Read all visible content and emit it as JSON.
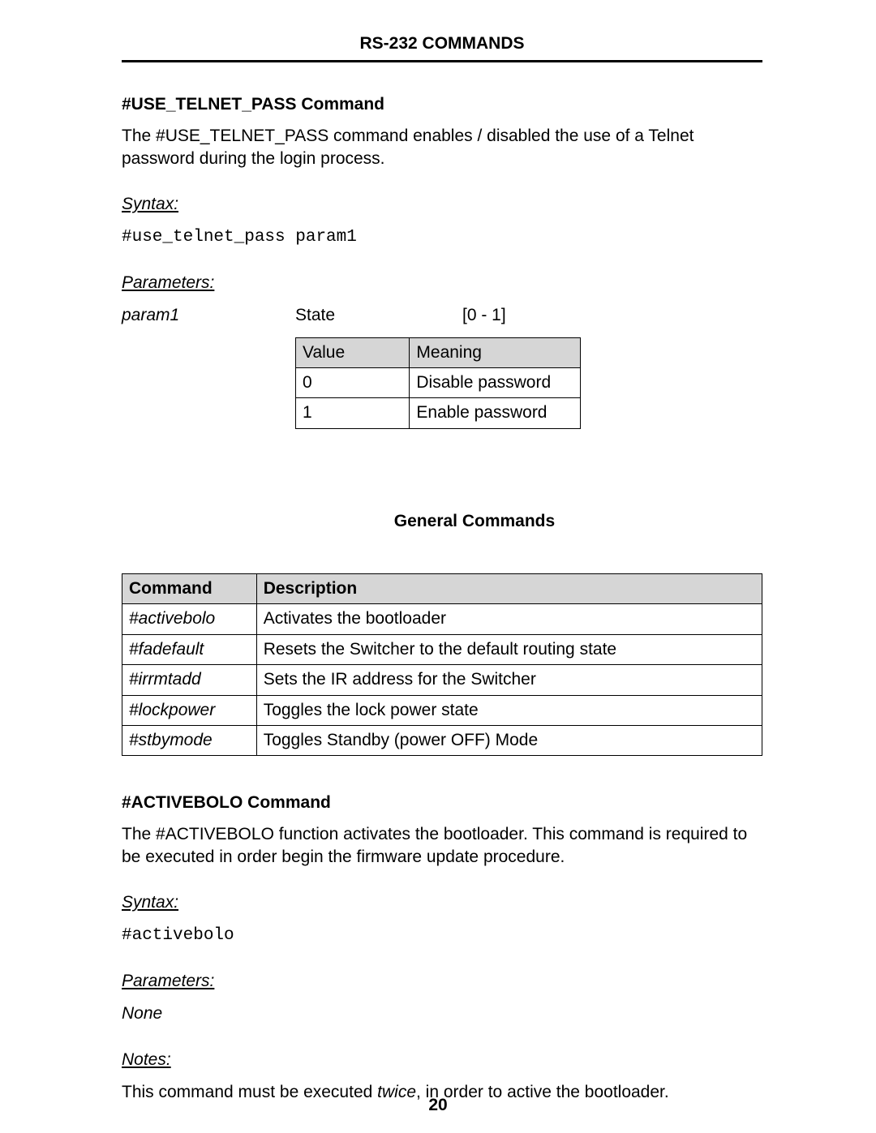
{
  "header": {
    "title": "RS-232 COMMANDS"
  },
  "section1": {
    "heading": "#USE_TELNET_PASS Command",
    "body": "The #USE_TELNET_PASS command enables / disabled the use of a Telnet password during the login process.",
    "syntax_label": "Syntax:",
    "syntax_code": "#use_telnet_pass param1",
    "parameters_label": "Parameters:",
    "param": {
      "name": "param1",
      "label": "State",
      "range": "[0 - 1]"
    },
    "value_headers": {
      "col1": "Value",
      "col2": "Meaning"
    },
    "value_rows": [
      {
        "v": "0",
        "m": "Disable password"
      },
      {
        "v": "1",
        "m": "Enable password"
      }
    ]
  },
  "general": {
    "heading": "General Commands",
    "headers": {
      "col1": "Command",
      "col2": "Description"
    },
    "rows": [
      {
        "cmd": "#activebolo",
        "desc": "Activates the bootloader"
      },
      {
        "cmd": "#fadefault",
        "desc": "Resets the Switcher to the default routing state"
      },
      {
        "cmd": "#irrmtadd",
        "desc": "Sets the IR address for the Switcher"
      },
      {
        "cmd": "#lockpower",
        "desc": "Toggles the lock power state"
      },
      {
        "cmd": "#stbymode",
        "desc": "Toggles Standby (power OFF) Mode"
      }
    ]
  },
  "section2": {
    "heading": "#ACTIVEBOLO Command",
    "body": "The #ACTIVEBOLO function activates the bootloader.  This command is required to be executed in order begin the firmware update procedure.",
    "syntax_label": "Syntax:",
    "syntax_code": "#activebolo",
    "parameters_label": "Parameters:",
    "parameters_value": "None",
    "notes_label": "Notes:",
    "notes_prefix": "This command must be executed ",
    "notes_italic": "twice",
    "notes_suffix": ", in order to active the bootloader."
  },
  "footer": {
    "page_number": "20"
  }
}
